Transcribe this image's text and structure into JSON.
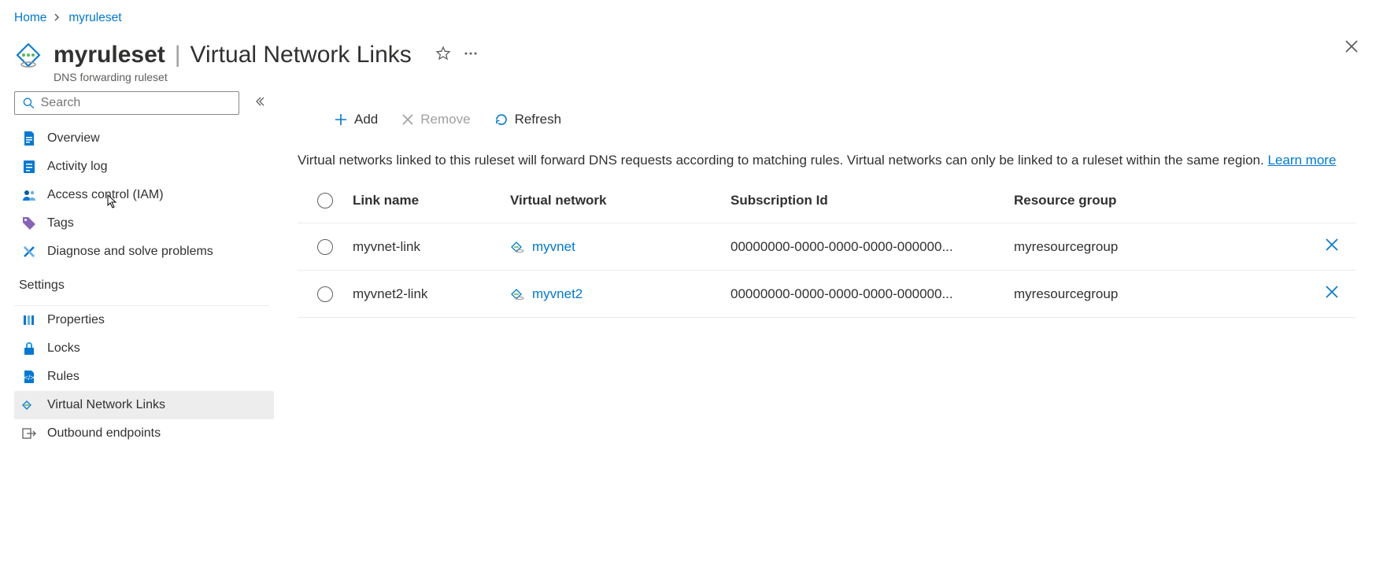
{
  "breadcrumb": {
    "home": "Home",
    "current": "myruleset"
  },
  "header": {
    "name": "myruleset",
    "page": "Virtual Network Links",
    "subtitle": "DNS forwarding ruleset"
  },
  "search": {
    "placeholder": "Search"
  },
  "sidebar": {
    "items": [
      {
        "label": "Overview"
      },
      {
        "label": "Activity log"
      },
      {
        "label": "Access control (IAM)"
      },
      {
        "label": "Tags"
      },
      {
        "label": "Diagnose and solve problems"
      }
    ],
    "section_title": "Settings",
    "settings": [
      {
        "label": "Properties"
      },
      {
        "label": "Locks"
      },
      {
        "label": "Rules"
      },
      {
        "label": "Virtual Network Links"
      },
      {
        "label": "Outbound endpoints"
      }
    ]
  },
  "toolbar": {
    "add": "Add",
    "remove": "Remove",
    "refresh": "Refresh"
  },
  "description": {
    "text": "Virtual networks linked to this ruleset will forward DNS requests according to matching rules. Virtual networks can only be linked to a ruleset within the same region. ",
    "learn": "Learn more"
  },
  "table": {
    "headers": {
      "link_name": "Link name",
      "vnet": "Virtual network",
      "sub": "Subscription Id",
      "rg": "Resource group"
    },
    "rows": [
      {
        "link_name": "myvnet-link",
        "vnet": "myvnet",
        "sub": "00000000-0000-0000-0000-000000...",
        "rg": "myresourcegroup"
      },
      {
        "link_name": "myvnet2-link",
        "vnet": "myvnet2",
        "sub": "00000000-0000-0000-0000-000000...",
        "rg": "myresourcegroup"
      }
    ]
  }
}
